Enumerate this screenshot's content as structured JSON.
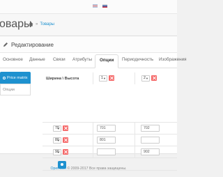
{
  "header": {
    "title": "овары",
    "breadcrumb": "Товары"
  },
  "panel": {
    "title": "Редактирование"
  },
  "tabs": [
    "Основное",
    "Данные",
    "Связи",
    "Атрибуты",
    "Опции",
    "Периодичность",
    "Изображения"
  ],
  "active_tab": "Опции",
  "sidenav": {
    "items": [
      "Price matrix",
      "Опции"
    ]
  },
  "matrix": {
    "corner_label": "Ширина \\ Высота",
    "columns": [
      "1",
      "2"
    ],
    "rows": [
      {
        "key": "70",
        "values": [
          "701",
          "702"
        ]
      },
      {
        "key": "80",
        "values": [
          "801",
          ""
        ]
      },
      {
        "key": "90",
        "values": [
          "",
          "902"
        ]
      }
    ]
  },
  "footer": {
    "brand": "OpenCart",
    "text": " © 2009-2017 Все права защищены."
  }
}
